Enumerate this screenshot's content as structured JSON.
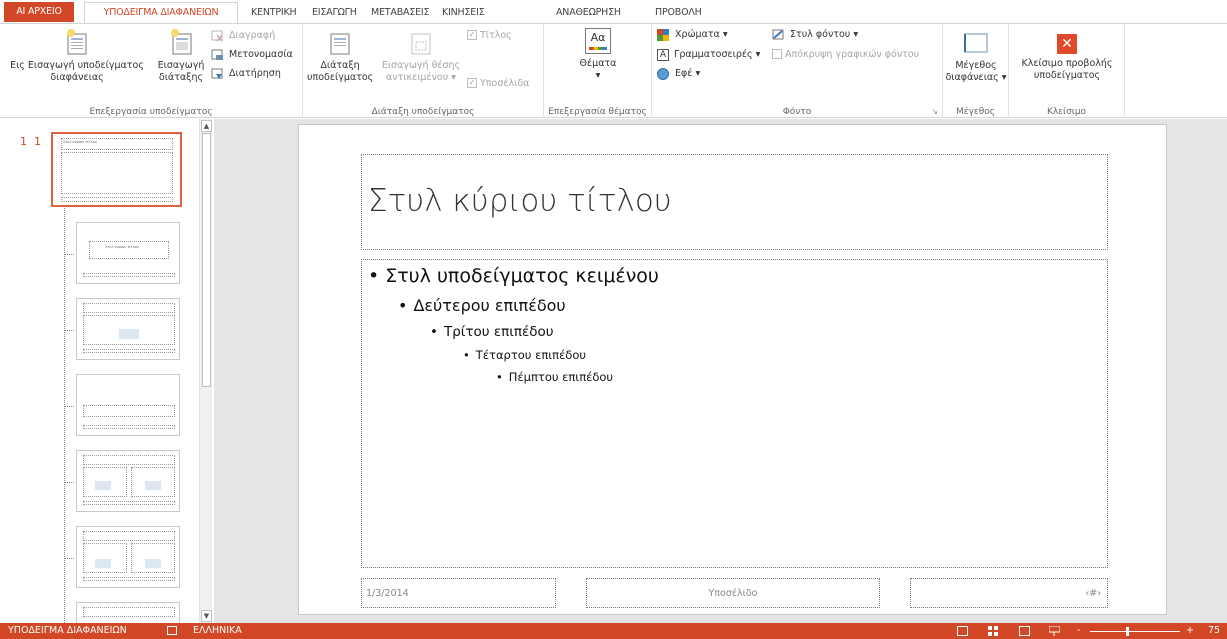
{
  "tabs": {
    "file": "ΑΡΧΕΙΟ",
    "file_prefix": "ΑΙ",
    "slide_master": "ΥΠΟΔΕΙΓΜΑ ΔΙΑΦΑΝΕΙΩΝ",
    "home": "ΚΕΝΤΡΙΚΗ",
    "insert": "ΕΙΣΑΓΩΓΗ",
    "transitions": "ΜΕΤΑΒΑΣΕΙΣ",
    "animations": "ΚΙΝΗΣΕΙΣ",
    "review": "ΑΝΑΘΕΩΡΗΣΗ",
    "view": "ΠΡΟΒΟΛΗ"
  },
  "ribbon": {
    "edit_master": {
      "label": "Επεξεργασία υποδείγματος",
      "insert_slide_master_line1": "Εισαγωγή υποδείγματος",
      "insert_slide_master_line2": "διαφάνειας",
      "insert_slide_master_prefix": "Εις",
      "insert_layout_line1": "Εισαγωγή",
      "insert_layout_line2": "διάταξης",
      "delete": "Διαγραφή",
      "rename": "Μετονομασία",
      "preserve": "Διατήρηση"
    },
    "master_layout": {
      "label": "Διάταξη υποδείγματος",
      "master_layout_line1": "Διάταξη",
      "master_layout_line2": "υποδείγματος",
      "insert_placeholder_line1": "Εισαγωγή θέσης",
      "insert_placeholder_line2": "αντικειμένου",
      "title": "Τίτλος",
      "footers": "Υποσέλιδα"
    },
    "edit_theme": {
      "label": "Επεξεργασία θέματος",
      "themes": "Θέματα",
      "themes_icon_text": "Aα"
    },
    "background": {
      "label": "Φόντο",
      "colors": "Χρώματα",
      "fonts": "Γραμματοσειρές",
      "effects": "Εφέ",
      "background_styles": "Στυλ φόντου",
      "hide_bg_graphics": "Απόκρυψη γραφικών φόντου"
    },
    "size": {
      "label": "Μέγεθος",
      "slide_size_line1": "Μέγεθος",
      "slide_size_line2": "διαφάνειας"
    },
    "close": {
      "label": "Κλείσιμο",
      "close_master_line1": "Κλείσιμο προβολής",
      "close_master_line2": "υποδείγματος"
    }
  },
  "thumbnails": {
    "number": "1",
    "number2": "1",
    "master_title": "Στυλ κύριου τίτλου",
    "layout_title": "Στυλ κύριου τίτλου"
  },
  "slide": {
    "title": "Στυλ κύριου τίτλου",
    "level1": "Στυλ υποδείγματος κειμένου",
    "level2": "Δεύτερου επιπέδου",
    "level3": "Τρίτου επιπέδου",
    "level4": "Τέταρτου επιπέδου",
    "level5": "Πέμπτου επιπέδου",
    "date": "1/3/2014",
    "footer": "Υποσέλιδο",
    "slide_number": "‹#›"
  },
  "status": {
    "view_name": "ΥΠΟΔΕΙΓΜΑ ΔΙΑΦΑΝΕΙΩΝ",
    "language": "ΕΛΛΗΝΙΚΑ",
    "zoom": "75",
    "zoom_minus": "-",
    "zoom_plus": "+"
  },
  "colors": {
    "accent": "#d24726",
    "canvas_bg": "#e5e5e5"
  }
}
